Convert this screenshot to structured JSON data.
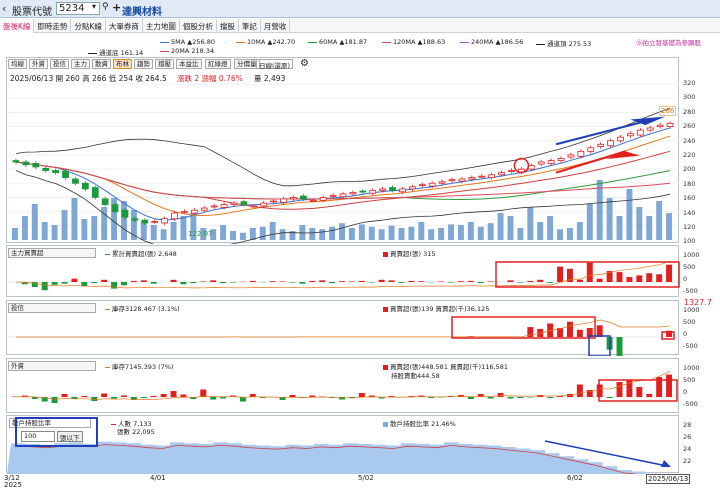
{
  "topbar": {
    "title": "股票代號",
    "code": "5234",
    "stock_name": "達興材料"
  },
  "tabs": [
    "盤後K線",
    "即時走勢",
    "分點K線",
    "大單券商",
    "主力地圖",
    "個股分析",
    "擋股",
    "筆記",
    "月營收"
  ],
  "ma_legend": {
    "row1": [
      {
        "label": "5MA ▲256.80",
        "color": "#3a6fd8"
      },
      {
        "label": "10MA ▲242.70",
        "color": "#e07a1c"
      },
      {
        "label": "60MA ▲181.87",
        "color": "#2f9a3a"
      },
      {
        "label": "120MA ▲188.63",
        "color": "#e34a5a"
      },
      {
        "label": "240MA ▲186.56",
        "color": "#b45ad8"
      },
      {
        "label": "通道頂 275.53",
        "color": "#222222"
      }
    ],
    "row2": [
      {
        "label": "通道底 161.14",
        "color": "#222222"
      },
      {
        "label": "20MA 218.34",
        "color": "#d04040"
      }
    ],
    "notice": "⓪拍立發基礎為參顯股"
  },
  "toolbar": {
    "buttons": [
      "均線",
      "外資",
      "投信",
      "主力",
      "散資",
      "布林",
      "趨勢",
      "撐壓",
      "本益比",
      "紅綠燈",
      "分價量"
    ],
    "active": "布林",
    "period": "日線(還原)"
  },
  "ohlc_text": "2025/06/13 開 260  高 266  低 254  收 264.5",
  "change_text": "漲跌 2  漲幅 0.76%",
  "volume_text": "量 2,493",
  "price_axis": [
    "320",
    "300",
    "280",
    "260",
    "240",
    "220",
    "200",
    "180",
    "160",
    "140",
    "120",
    "100"
  ],
  "price_labels": {
    "high": "266",
    "low": "122.97"
  },
  "panel1": {
    "name": "主力買賣超",
    "legend_a": "累計買賣超(張) 2,648",
    "legend_b": "買賣超(張) 315",
    "axis": [
      "1000",
      "500",
      "0",
      "-500"
    ]
  },
  "panel2": {
    "name": "投信",
    "legend_a": "庫存3128.467 (3.1%)",
    "legend_b": "買賣超(張)139 買賣超(千)36,125",
    "axis": [
      "1000",
      "500",
      "0",
      "-500"
    ],
    "side_value": "1327.7"
  },
  "panel3": {
    "name": "外資",
    "legend_a": "庫存7145.393 (7%)",
    "legend_b": "買賣超(張)448.581 買賣超(千)116,581",
    "legend_c": "持股賣動444.58",
    "axis": [
      "1000",
      "500",
      "0",
      "-500"
    ]
  },
  "panel4": {
    "name": "散戶持股比率",
    "legend_a": "人數 7,133",
    "legend_b": "張數 22,095",
    "legend_c": "散戶持股比率 21.46%",
    "select_value": "100",
    "select_btn": "張以下",
    "axis": [
      "28",
      "26",
      "24",
      "22"
    ]
  },
  "x_axis": {
    "labels": [
      "3/12",
      "4/01",
      "5/02",
      "6/02"
    ],
    "year": "2025",
    "current": "2025/06/13"
  },
  "colors": {
    "up": "#e21f1f",
    "down": "#1a9a3a",
    "volume": "#7fa7d6",
    "channel": "#222222"
  },
  "chart_data": {
    "type": "candlestick",
    "price_range": [
      100,
      320
    ],
    "close_series": [
      210,
      206,
      203,
      198,
      195,
      188,
      180,
      172,
      160,
      150,
      140,
      132,
      128,
      124,
      126,
      130,
      138,
      140,
      142,
      145,
      148,
      150,
      152,
      150,
      148,
      152,
      155,
      158,
      160,
      158,
      156,
      160,
      163,
      165,
      167,
      168,
      170,
      172,
      170,
      172,
      175,
      178,
      180,
      182,
      185,
      186,
      188,
      190,
      192,
      195,
      198,
      200,
      205,
      210,
      212,
      215,
      220,
      225,
      230,
      235,
      240,
      245,
      250,
      255,
      258,
      262,
      264.5
    ],
    "volume_series": [
      20,
      40,
      60,
      30,
      25,
      50,
      70,
      35,
      40,
      55,
      70,
      65,
      50,
      30,
      25,
      18,
      30,
      40,
      45,
      20,
      18,
      25,
      15,
      12,
      20,
      22,
      30,
      18,
      15,
      25,
      20,
      18,
      22,
      28,
      20,
      26,
      22,
      18,
      24,
      20,
      22,
      30,
      18,
      20,
      26,
      25,
      30,
      22,
      28,
      45,
      40,
      20,
      55,
      30,
      40,
      18,
      20,
      30,
      60,
      100,
      70,
      40,
      85,
      55,
      40,
      65,
      45
    ],
    "panel1_values": [
      0,
      -40,
      -90,
      -150,
      -50,
      -30,
      60,
      -80,
      -20,
      40,
      -120,
      -60,
      20,
      30,
      -30,
      0,
      40,
      -40,
      -20,
      10,
      30,
      -20,
      -10,
      5,
      20,
      -5,
      15,
      10,
      -10,
      -30,
      20,
      30,
      -20,
      15,
      10,
      20,
      -10,
      40,
      30,
      -15,
      20,
      15,
      -5,
      10,
      -10,
      15,
      20,
      -20,
      10,
      0,
      30,
      -10,
      20,
      40,
      -15,
      280,
      240,
      40,
      350,
      60,
      200,
      180,
      90,
      120,
      160,
      140,
      315
    ],
    "panel2_values": [
      0,
      0,
      0,
      0,
      0,
      0,
      0,
      0,
      0,
      0,
      0,
      0,
      0,
      0,
      0,
      0,
      0,
      0,
      0,
      0,
      0,
      0,
      10,
      -5,
      0,
      0,
      0,
      0,
      0,
      5,
      0,
      0,
      0,
      0,
      0,
      0,
      0,
      0,
      0,
      0,
      0,
      0,
      0,
      0,
      0,
      0,
      20,
      0,
      0,
      0,
      0,
      0,
      220,
      180,
      300,
      200,
      340,
      160,
      200,
      260,
      -280,
      -500,
      0,
      0,
      0,
      0,
      139
    ],
    "panel3_values": [
      10,
      30,
      -40,
      -90,
      -120,
      60,
      -40,
      20,
      -80,
      70,
      -30,
      30,
      -60,
      -20,
      20,
      60,
      120,
      50,
      -40,
      150,
      -50,
      -30,
      30,
      -90,
      60,
      -20,
      -10,
      -60,
      40,
      -20,
      30,
      10,
      -20,
      -50,
      -20,
      80,
      30,
      -30,
      20,
      -10,
      20,
      30,
      -20,
      -10,
      20,
      40,
      -40,
      60,
      -30,
      80,
      -30,
      -20,
      -10,
      40,
      -20,
      20,
      60,
      250,
      140,
      250,
      -20,
      300,
      350,
      200,
      60,
      400,
      448
    ],
    "panel4_ratio": [
      25.5,
      25.4,
      25.3,
      25.5,
      25.6,
      25.4,
      25.7,
      25.6,
      25.5,
      25.3,
      25.2,
      25.6,
      25.5,
      25.4,
      25.6,
      25.5,
      25.3,
      25.2,
      25.1,
      25.3,
      25.2,
      25.4,
      25.3,
      25.5,
      25.4,
      25.3,
      25.2,
      25.5,
      25.4,
      25.3,
      25.6,
      25.4,
      25.3,
      25.2,
      25.0,
      24.8,
      24.6,
      24.2,
      23.8,
      23.4,
      23.0,
      22.5,
      22.0,
      21.8,
      21.5,
      21.46
    ]
  }
}
